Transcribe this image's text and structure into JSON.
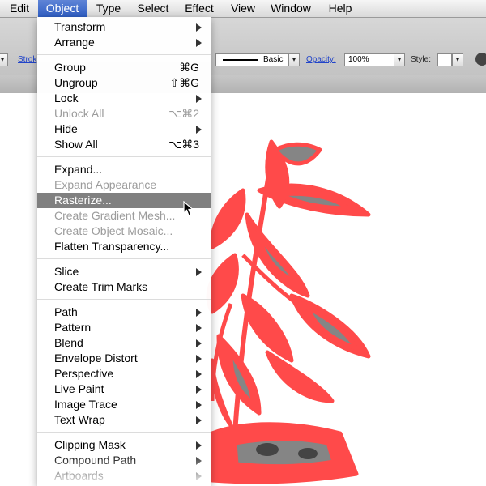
{
  "menubar": {
    "items": [
      "Edit",
      "Object",
      "Type",
      "Select",
      "Effect",
      "View",
      "Window",
      "Help"
    ],
    "active": "Object"
  },
  "control": {
    "stroke_label": "Strok",
    "brush_label": "Basic",
    "opacity_label": "Opacity:",
    "opacity_value": "100%",
    "style_label": "Style:"
  },
  "menu": {
    "items": [
      {
        "label": "Transform",
        "submenu": true
      },
      {
        "label": "Arrange",
        "submenu": true
      },
      {
        "separator": true
      },
      {
        "label": "Group",
        "shortcut": "⌘G"
      },
      {
        "label": "Ungroup",
        "shortcut": "⇧⌘G"
      },
      {
        "label": "Lock",
        "submenu": true
      },
      {
        "label": "Unlock All",
        "shortcut": "⌥⌘2",
        "disabled": true
      },
      {
        "label": "Hide",
        "submenu": true
      },
      {
        "label": "Show All",
        "shortcut": "⌥⌘3"
      },
      {
        "separator": true
      },
      {
        "label": "Expand..."
      },
      {
        "label": "Expand Appearance",
        "disabled": true
      },
      {
        "label": "Rasterize...",
        "highlighted": true
      },
      {
        "label": "Create Gradient Mesh...",
        "disabled": true
      },
      {
        "label": "Create Object Mosaic...",
        "disabled": true
      },
      {
        "label": "Flatten Transparency..."
      },
      {
        "separator": true
      },
      {
        "label": "Slice",
        "submenu": true
      },
      {
        "label": "Create Trim Marks"
      },
      {
        "separator": true
      },
      {
        "label": "Path",
        "submenu": true
      },
      {
        "label": "Pattern",
        "submenu": true
      },
      {
        "label": "Blend",
        "submenu": true
      },
      {
        "label": "Envelope Distort",
        "submenu": true
      },
      {
        "label": "Perspective",
        "submenu": true
      },
      {
        "label": "Live Paint",
        "submenu": true
      },
      {
        "label": "Image Trace",
        "submenu": true
      },
      {
        "label": "Text Wrap",
        "submenu": true
      },
      {
        "separator": true
      },
      {
        "label": "Clipping Mask",
        "submenu": true
      },
      {
        "label": "Compound Path",
        "submenu": true
      },
      {
        "label": "Artboards",
        "submenu": true
      }
    ]
  },
  "colors": {
    "selection_red": "#ff4a4a",
    "fill_gray": "#858585",
    "menu_highlight": "#808080"
  }
}
